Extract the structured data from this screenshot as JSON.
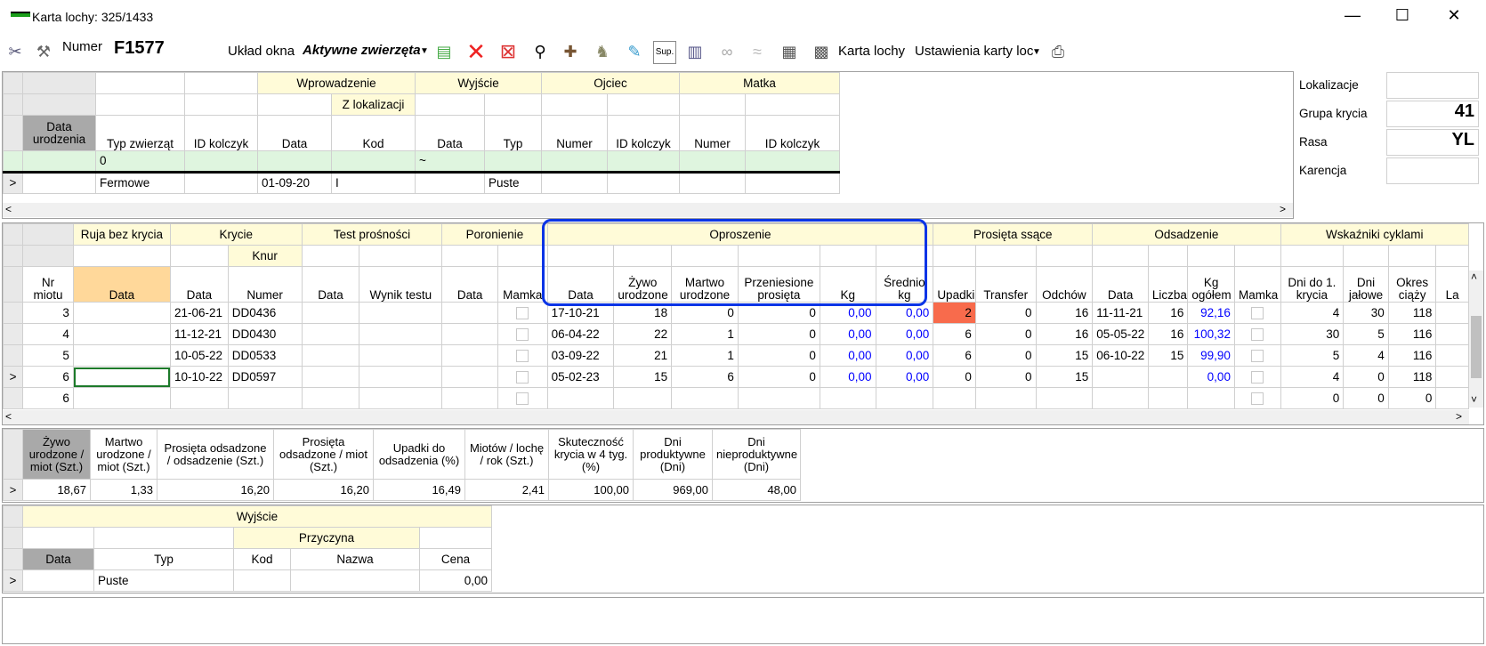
{
  "window": {
    "title": "Karta lochy: 325/1433",
    "minimize": "—",
    "maximize": "☐",
    "close": "✕"
  },
  "toolbar": {
    "numer_label": "Numer",
    "numer_value": "F1577",
    "uklad_label": "Układ okna",
    "uklad_value": "Aktywne zwierzęta",
    "karta_lochy": "Karta lochy",
    "ustawienia": "Ustawienia karty loc",
    "sup": "Sup."
  },
  "top_table": {
    "group_headers": {
      "wprowadzenie": "Wprowadzenie",
      "wyjscie": "Wyjście",
      "ojciec": "Ojciec",
      "matka": "Matka",
      "z_lokalizacji": "Z lokalizacji"
    },
    "columns": {
      "data_urodzenia": "Data urodzenia",
      "typ": "Typ zwierząt",
      "id_kolczyk": "ID kolczyk",
      "data": "Data",
      "kod": "Kod",
      "data2": "Data",
      "typ2": "Typ",
      "numer": "Numer",
      "id_kolczyk2": "ID kolczyk",
      "numer2": "Numer",
      "id_kolczyk3": "ID kolczyk"
    },
    "filter_row": {
      "typ": "0",
      "data2": "~"
    },
    "row": {
      "indicator": ">",
      "typ": "Fermowe",
      "data": "01-09-20",
      "kod": "I",
      "typ2": "Puste"
    }
  },
  "side": {
    "lokalizacje": "Lokalizacje",
    "grupa_krycia": "Grupa krycia",
    "grupa_krycia_value": "41",
    "rasa": "Rasa",
    "rasa_value": "YL",
    "karencja": "Karencja"
  },
  "mid_table": {
    "group_headers": {
      "ruja": "Ruja bez krycia",
      "krycie": "Krycie",
      "knur": "Knur",
      "test": "Test prośności",
      "poronienie": "Poronienie",
      "oproszenie": "Oproszenie",
      "prosieta": "Prosięta ssące",
      "odsadzenie": "Odsadzenie",
      "wskazniki": "Wskaźniki cyklami"
    },
    "columns": {
      "nr_miotu": "Nr miotu",
      "ruja_data": "Data",
      "krycie_data": "Data",
      "knur_numer": "Numer",
      "test_data": "Data",
      "wynik": "Wynik testu",
      "poronienie_data": "Data",
      "mamka": "Mamka",
      "opr_data": "Data",
      "zywo": "Żywo urodzone",
      "martwo": "Martwo urodzone",
      "przeniesione": "Przeniesione prosięta",
      "kg": "Kg",
      "srednio": "Średnio kg",
      "upadki": "Upadki",
      "transfer": "Transfer",
      "odchow": "Odchów",
      "ods_data": "Data",
      "liczba": "Liczba",
      "kg_ogolem": "Kg ogółem",
      "mamka2": "Mamka",
      "dni_do": "Dni do 1. krycia",
      "dni_jalowe": "Dni jałowe",
      "okres": "Okres ciąży",
      "la": "La"
    },
    "rows": [
      {
        "ind": "",
        "nr": "3",
        "krycie_data": "21-06-21",
        "knur": "DD0436",
        "opr_data": "17-10-21",
        "zywo": "18",
        "martwo": "0",
        "przen": "0",
        "kg": "0,00",
        "sr": "0,00",
        "upadki": "2",
        "transfer": "0",
        "odchow": "16",
        "ods_data": "11-11-21",
        "liczba": "16",
        "kg_og": "92,16",
        "dni_do": "4",
        "jalowe": "30",
        "okres": "118"
      },
      {
        "ind": "",
        "nr": "4",
        "krycie_data": "11-12-21",
        "knur": "DD0430",
        "opr_data": "06-04-22",
        "zywo": "22",
        "martwo": "1",
        "przen": "0",
        "kg": "0,00",
        "sr": "0,00",
        "upadki": "6",
        "transfer": "0",
        "odchow": "16",
        "ods_data": "05-05-22",
        "liczba": "16",
        "kg_og": "100,32",
        "dni_do": "30",
        "jalowe": "5",
        "okres": "116"
      },
      {
        "ind": "",
        "nr": "5",
        "krycie_data": "10-05-22",
        "knur": "DD0533",
        "opr_data": "03-09-22",
        "zywo": "21",
        "martwo": "1",
        "przen": "0",
        "kg": "0,00",
        "sr": "0,00",
        "upadki": "6",
        "transfer": "0",
        "odchow": "15",
        "ods_data": "06-10-22",
        "liczba": "15",
        "kg_og": "99,90",
        "dni_do": "5",
        "jalowe": "4",
        "okres": "116"
      },
      {
        "ind": ">",
        "nr": "6",
        "krycie_data": "10-10-22",
        "knur": "DD0597",
        "opr_data": "05-02-23",
        "zywo": "15",
        "martwo": "6",
        "przen": "0",
        "kg": "0,00",
        "sr": "0,00",
        "upadki": "0",
        "transfer": "0",
        "odchow": "15",
        "ods_data": "",
        "liczba": "",
        "kg_og": "0,00",
        "dni_do": "4",
        "jalowe": "0",
        "okres": "118"
      },
      {
        "ind": "",
        "nr": "6",
        "krycie_data": "",
        "knur": "",
        "opr_data": "",
        "zywo": "",
        "martwo": "",
        "przen": "",
        "kg": "",
        "sr": "",
        "upadki": "",
        "transfer": "",
        "odchow": "",
        "ods_data": "",
        "liczba": "",
        "kg_og": "",
        "dni_do": "0",
        "jalowe": "0",
        "okres": "0"
      }
    ]
  },
  "summary": {
    "headers": [
      "Żywo urodzone / miot (Szt.)",
      "Martwo urodzone / miot (Szt.)",
      "Prosięta odsadzone / odsadzenie (Szt.)",
      "Prosięta odsadzone / miot (Szt.)",
      "Upadki do odsadzenia (%)",
      "Miotów / lochę / rok (Szt.)",
      "Skuteczność krycia w 4 tyg. (%)",
      "Dni produktywne (Dni)",
      "Dni nieproduktywne (Dni)"
    ],
    "values": [
      "18,67",
      "1,33",
      "16,20",
      "16,20",
      "16,49",
      "2,41",
      "100,00",
      "969,00",
      "48,00"
    ],
    "ind": ">"
  },
  "exit_table": {
    "wyjscie": "Wyjście",
    "przyczyna": "Przyczyna",
    "data": "Data",
    "typ": "Typ",
    "kod": "Kod",
    "nazwa": "Nazwa",
    "cena": "Cena",
    "row_ind": ">",
    "row_typ": "Puste",
    "row_cena": "0,00"
  }
}
